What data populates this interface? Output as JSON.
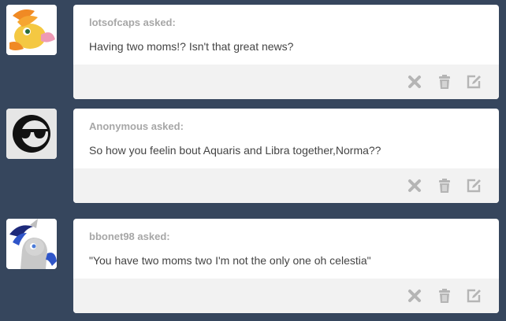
{
  "posts": [
    {
      "asker": "lotsofcaps asked:",
      "question": "Having two moms!? Isn't that great news?",
      "avatar_icon": "pony-avatar-icon"
    },
    {
      "asker": "Anonymous asked:",
      "question": "So how you feelin bout Aquaris and Libra together,Norma??",
      "avatar_icon": "anonymous-sunglasses-icon"
    },
    {
      "asker": "bbonet98 asked:",
      "question": "\"You have two moms two I'm not the only one oh celestia\"",
      "avatar_icon": "pony-avatar-icon"
    }
  ],
  "actions": [
    "delete-icon",
    "trash-icon",
    "edit-icon"
  ],
  "colors": {
    "background": "#36465d",
    "card": "#ffffff",
    "footer": "#f2f2f2",
    "icon": "#b5b5b5",
    "asker": "#a7a7a7",
    "question": "#444444"
  }
}
